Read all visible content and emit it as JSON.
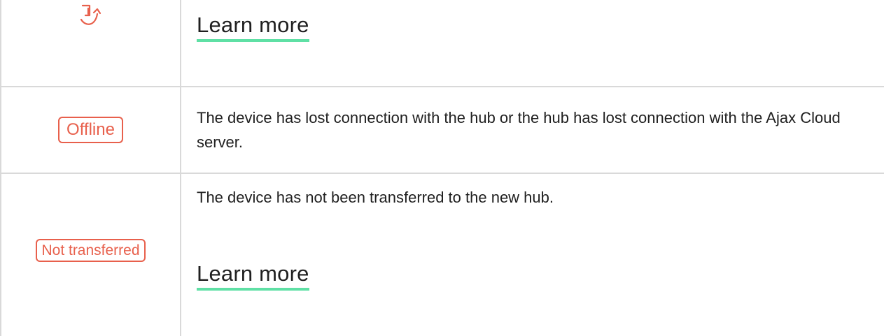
{
  "rows": [
    {
      "icon": "refresh-arrow-icon",
      "link_label": "Learn more"
    },
    {
      "badge": "Offline",
      "description": "The device has lost connection with the hub or the hub has lost connection with the Ajax Cloud server."
    },
    {
      "badge": "Not transferred",
      "description": "The device has not been transferred to the new hub.",
      "link_label": "Learn more"
    }
  ],
  "colors": {
    "badge_red": "#e8604c",
    "link_underline": "#5fe0a5",
    "border": "#d9d9d9",
    "text": "#1f1f1f"
  }
}
